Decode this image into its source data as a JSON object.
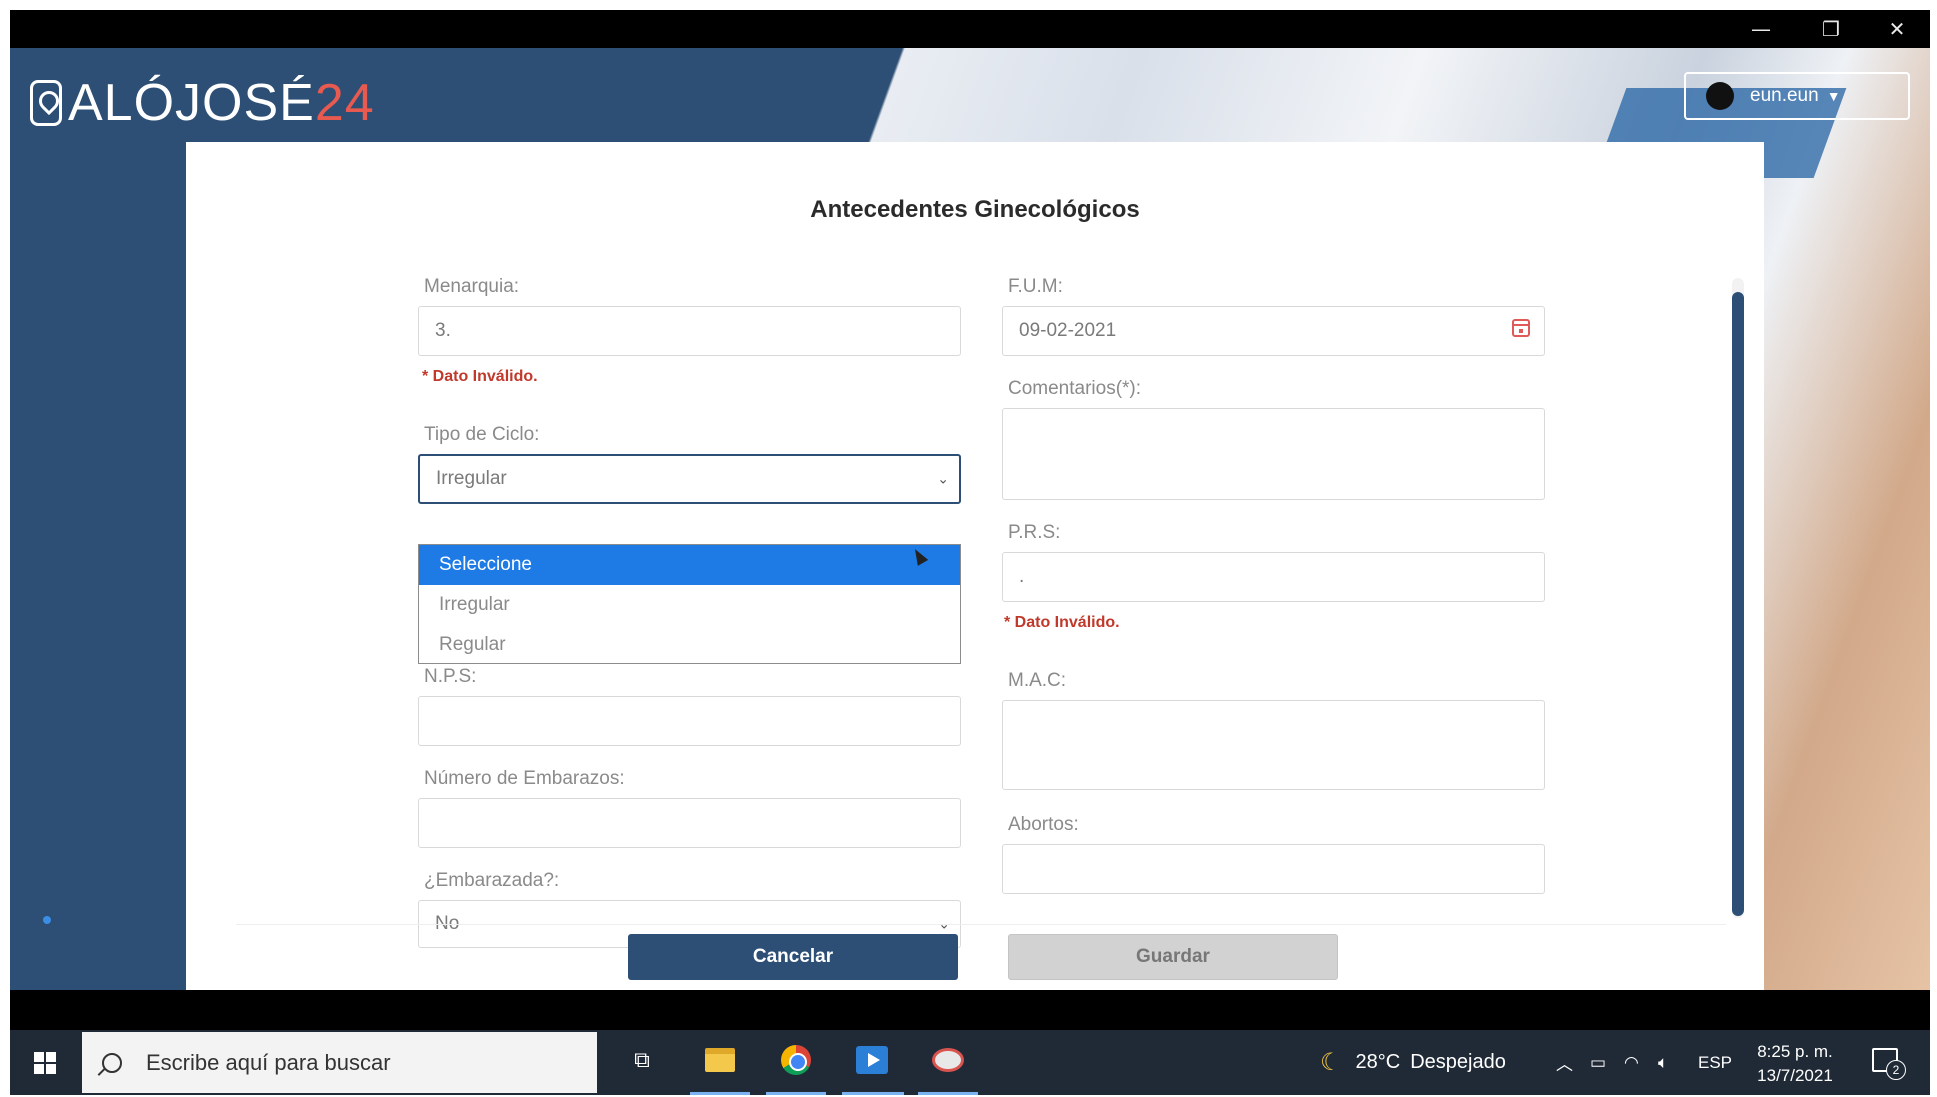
{
  "window": {
    "minimize_glyph": "—",
    "restore_glyph": "❐",
    "close_glyph": "✕"
  },
  "header": {
    "logo_text": "ALÓJOSÉ",
    "logo_number": "24",
    "user_name": "eun.eun"
  },
  "form": {
    "title": "Antecedentes Ginecológicos",
    "menarquia": {
      "label": "Menarquia:",
      "value": "3.",
      "error": "* Dato Inválido."
    },
    "tipo_ciclo": {
      "label": "Tipo de Ciclo:",
      "value": "Irregular",
      "options": [
        "Seleccione",
        "Irregular",
        "Regular"
      ],
      "highlighted": "Seleccione"
    },
    "nps": {
      "label": "N.P.S:",
      "value": ""
    },
    "num_embarazos": {
      "label": "Número de Embarazos:",
      "value": ""
    },
    "embarazada": {
      "label": "¿Embarazada?:",
      "value": "No"
    },
    "fum": {
      "label": "F.U.M:",
      "value": "09-02-2021"
    },
    "comentarios": {
      "label": "Comentarios(*):",
      "value": ""
    },
    "prs": {
      "label": "P.R.S:",
      "value": ".",
      "error": "* Dato Inválido."
    },
    "mac": {
      "label": "M.A.C:",
      "value": ""
    },
    "abortos": {
      "label": "Abortos:",
      "value": ""
    },
    "cancel_label": "Cancelar",
    "save_label": "Guardar"
  },
  "taskbar": {
    "search_placeholder": "Escribe aquí para buscar",
    "weather_temp": "28°C",
    "weather_desc": "Despejado",
    "lang": "ESP",
    "time": "8:25 p. m.",
    "date": "13/7/2021",
    "notifications": "2"
  },
  "colors": {
    "brand": "#2d4f75",
    "accent": "#e85a4f",
    "error": "#c0392b",
    "selection": "#1e7be6"
  }
}
